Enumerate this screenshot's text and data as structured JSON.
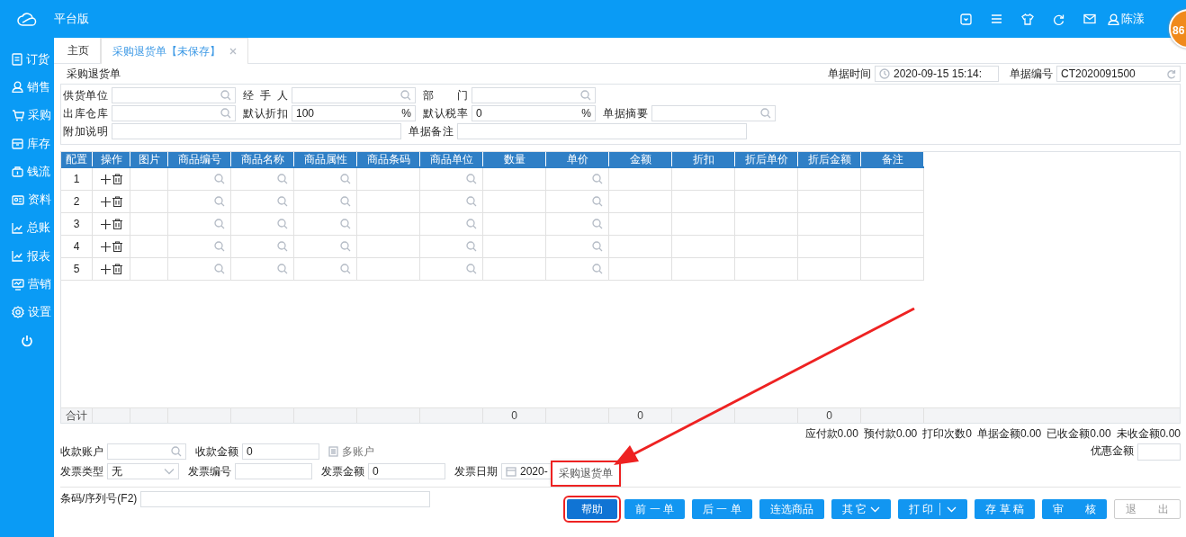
{
  "topbar": {
    "title": "平台版",
    "user": "陈漾",
    "badge": "86"
  },
  "sidebar": {
    "items": [
      {
        "label": "订货",
        "kind": "nav"
      },
      {
        "label": "销售",
        "kind": "nav"
      },
      {
        "label": "采购",
        "kind": "nav"
      },
      {
        "label": "库存",
        "kind": "nav"
      },
      {
        "label": "钱流",
        "kind": "nav"
      },
      {
        "label": "资料",
        "kind": "nav"
      },
      {
        "label": "总账",
        "kind": "nav"
      },
      {
        "label": "报表",
        "kind": "nav"
      },
      {
        "label": "营销",
        "kind": "nav"
      },
      {
        "label": "设置",
        "kind": "nav"
      },
      {
        "kind": "power"
      }
    ]
  },
  "tabs": [
    {
      "label": "主页",
      "selected": false,
      "closable": false
    },
    {
      "label": "采购退货单【未保存】",
      "selected": true,
      "closable": true
    }
  ],
  "header": {
    "title": "采购退货单",
    "fields": [
      {
        "label": "单据时间",
        "value": "2020-09-15 15:14:",
        "kind": "time"
      },
      {
        "label": "单据编号",
        "value": "CT2020091500",
        "kind": "refresh"
      }
    ]
  },
  "form": {
    "fields": [
      {
        "label": "供货单位",
        "kind": "search"
      },
      {
        "label": "经 手 人",
        "kind": "search"
      },
      {
        "label": "部　　门",
        "kind": "search"
      }
    ],
    "defaults": [
      {
        "label": "出库仓库",
        "kind": "search"
      },
      {
        "label": "默认折扣",
        "value": "100",
        "kind": "percent",
        "suffix": "%"
      },
      {
        "label": "默认税率",
        "value": "0",
        "kind": "percent",
        "suffix": "%"
      },
      {
        "label": "单据摘要",
        "kind": "search"
      }
    ],
    "remarks": [
      {
        "label": "附加说明",
        "kind": "long"
      },
      {
        "label": "单据备注",
        "kind": "long"
      }
    ]
  },
  "table": {
    "columns": [
      {
        "label": "配置",
        "search": false
      },
      {
        "label": "操作",
        "search": false
      },
      {
        "label": "图片",
        "search": false
      },
      {
        "label": "商品编号",
        "search": true
      },
      {
        "label": "商品名称",
        "search": true
      },
      {
        "label": "商品属性",
        "search": true
      },
      {
        "label": "商品条码",
        "search": false
      },
      {
        "label": "商品单位",
        "search": true
      },
      {
        "label": "数量",
        "search": false
      },
      {
        "label": "单价",
        "search": true
      },
      {
        "label": "金额",
        "search": false
      },
      {
        "label": "折扣",
        "search": false
      },
      {
        "label": "折后单价",
        "search": false
      },
      {
        "label": "折后金额",
        "search": false
      },
      {
        "label": "备注",
        "search": false
      }
    ],
    "rows": [
      {
        "index": "1"
      },
      {
        "index": "2"
      },
      {
        "index": "3"
      },
      {
        "index": "4"
      },
      {
        "index": "5"
      }
    ],
    "total": {
      "label": "合计",
      "cells": [
        "",
        "",
        "",
        "",
        "",
        "",
        "",
        "0",
        "",
        "0",
        "",
        "",
        "0",
        ""
      ]
    }
  },
  "summary": [
    "应付款0.00",
    "预付款0.00",
    "打印次数0",
    "单据金额0.00",
    "已收金额0.00",
    "未收金额0.00"
  ],
  "payment": {
    "account": [
      {
        "label": "收款账户",
        "kind": "search"
      },
      {
        "label": "收款金额",
        "value": "0",
        "kind": "text"
      },
      {
        "label": "多账户",
        "kind": "link"
      }
    ],
    "invoice": [
      {
        "label": "发票类型",
        "value": "无",
        "kind": "select"
      },
      {
        "label": "发票编号",
        "kind": "text"
      },
      {
        "label": "发票金额",
        "value": "0",
        "kind": "text"
      },
      {
        "label": "发票日期",
        "value": "2020-",
        "kind": "date"
      }
    ],
    "discount": {
      "label": "优惠金额"
    }
  },
  "tooltip": {
    "text": "采购退货单",
    "highlighted": true
  },
  "barcode": {
    "label": "条码/序列号(F2)"
  },
  "buttons": [
    {
      "label": "帮助",
      "kind": "plain",
      "highlighted": true,
      "disabled": false
    },
    {
      "label": "前 一 单",
      "kind": "plain",
      "highlighted": false,
      "disabled": false
    },
    {
      "label": "后 一 单",
      "kind": "plain",
      "highlighted": false,
      "disabled": false
    },
    {
      "label": "连选商品",
      "kind": "plain",
      "highlighted": false,
      "disabled": false
    },
    {
      "label": "其 它",
      "kind": "dropdown",
      "highlighted": false,
      "disabled": false
    },
    {
      "label": "打 印",
      "kind": "split",
      "highlighted": false,
      "disabled": false
    },
    {
      "label": "存 草 稿",
      "kind": "plain",
      "highlighted": false,
      "disabled": false
    },
    {
      "label": "审　　核",
      "kind": "plain",
      "highlighted": false,
      "disabled": false
    },
    {
      "label": "退　　出",
      "kind": "plain",
      "highlighted": false,
      "disabled": true
    }
  ],
  "annotation": {
    "arrow": true
  }
}
